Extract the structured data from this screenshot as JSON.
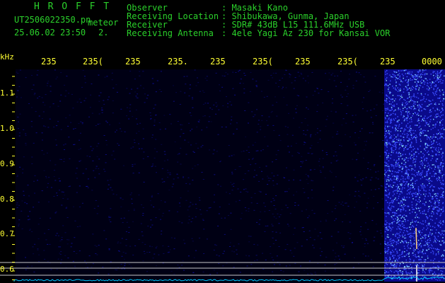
{
  "header": {
    "logo": "H R O F F T",
    "filename": "UT2506022350.pn",
    "tag": "meteor",
    "date": "25.06.02 23:50",
    "num": "2.",
    "fields": [
      {
        "label": "Observer",
        "value": ": Masaki Kano"
      },
      {
        "label": "Receiving Location",
        "value": ": Shibukawa, Gunma, Japan"
      },
      {
        "label": "Receiver",
        "value": ": SDR# 43dB L15 111.6MHz USB"
      },
      {
        "label": "Receiving Antenna",
        "value": ": 4ele Yagi Az 230 for Kansai VOR"
      }
    ]
  },
  "chart_data": {
    "type": "heatmap",
    "y_unit": "kHz",
    "y_ticks": [
      "1.1",
      "1.0",
      "0.9",
      "0.8",
      "0.7",
      "0.6"
    ],
    "x_ticks": [
      "235",
      "235(",
      "235",
      "235.",
      "235",
      "235(",
      "235",
      "235(",
      "235",
      "0000"
    ],
    "colors": {
      "background": "#000018",
      "noise": "#1a1aff",
      "bright": "#7fd0ff",
      "baseline": "#00c8ff"
    }
  }
}
